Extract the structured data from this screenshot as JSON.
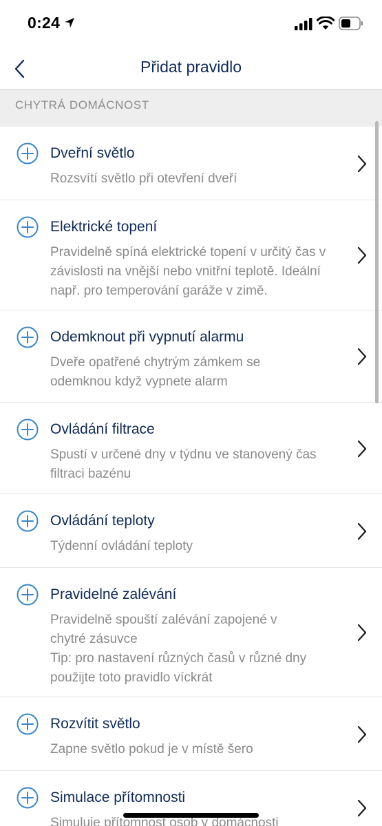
{
  "status": {
    "time": "0:24"
  },
  "nav": {
    "title": "Přidat pravidlo"
  },
  "section": {
    "title": "CHYTRÁ DOMÁCNOST"
  },
  "colors": {
    "accent": "#3a87c8",
    "title": "#0f2a57",
    "desc": "#8a8a8a",
    "section_bg": "#eeeeee"
  },
  "rules": [
    {
      "title": "Dveřní světlo",
      "desc": "Rozsvítí světlo při otevření dveří"
    },
    {
      "title": "Elektrické topení",
      "desc": "Pravidelně spíná elektrické topení v určitý čas v\nzávislosti na vnější nebo vnitřní teplotě. Ideální\nnapř. pro temperování garáže v zimě."
    },
    {
      "title": "Odemknout při vypnutí alarmu",
      "desc": "Dveře opatřené chytrým zámkem se\nodemknou když vypnete alarm"
    },
    {
      "title": "Ovládání filtrace",
      "desc": "Spustí v určené dny v týdnu ve stanovený čas\nfiltraci bazénu"
    },
    {
      "title": "Ovládání teploty",
      "desc": "Týdenní ovládání teploty"
    },
    {
      "title": "Pravidelné zalévání",
      "desc": "Pravidelně spouští zalévání zapojené v\nchytré zásuvce\nTip: pro nastavení různých časů v různé dny\npoužijte toto pravidlo víckrát"
    },
    {
      "title": "Rozvítit světlo",
      "desc": "Zapne světlo pokud je v místě šero"
    },
    {
      "title": "Simulace přítomnosti",
      "desc": "Simuluje přítomnost osob v domácnosti"
    }
  ]
}
